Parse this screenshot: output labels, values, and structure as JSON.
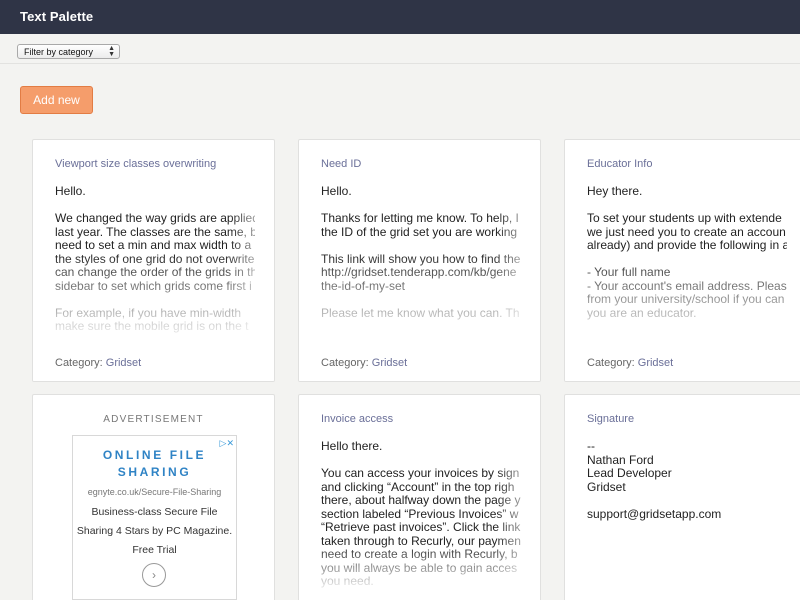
{
  "app": {
    "title": "Text Palette"
  },
  "filter": {
    "label": "Filter by category"
  },
  "actions": {
    "add_new": "Add new"
  },
  "category_prefix": "Category:",
  "cards": [
    {
      "title": "Viewport size classes overwriting",
      "lines": [
        "Hello.",
        "",
        "We changed the way grids are applied",
        "last year. The classes are the same, b",
        "need to set a min and max width to a",
        "the styles of one grid do not overwrite",
        "can change the order of the grids in th",
        "sidebar to set which grids come first i",
        "",
        "For example, if you have min-width",
        "make sure the mobile grid is on the t"
      ],
      "category": "Gridset"
    },
    {
      "title": "Need ID",
      "lines": [
        "Hello.",
        "",
        "Thanks for letting me know. To help, I",
        "the ID of the grid set you are working",
        "",
        "This link will show you how to find the",
        "http://gridset.tenderapp.com/kb/gene",
        "the-id-of-my-set",
        "",
        "Please let me know what you can. Th"
      ],
      "category": "Gridset"
    },
    {
      "title": "Educator Info",
      "lines": [
        "Hey there.",
        "",
        "To set your students up with extende",
        "we just need you to create an accoun",
        "already) and provide the following in a",
        "",
        "- Your full name",
        "- Your account's email address. Pleas",
        "from your university/school if you can",
        "you are an educator."
      ],
      "category": "Gridset"
    },
    {
      "title": "Invoice access",
      "lines": [
        "Hello there.",
        "",
        "You can access your invoices by sign",
        "and clicking “Account” in the top righ",
        "there, about halfway down the page y",
        "section labeled “Previous Invoices” w",
        "“Retrieve past invoices”. Click the link",
        "taken through to Recurly, our paymen",
        "need to create a login with Recurly, b",
        "you will always be able to gain acces",
        "you need."
      ]
    },
    {
      "title": "Signature",
      "lines": [
        "--",
        "Nathan Ford",
        "Lead Developer",
        "Gridset",
        "",
        "support@gridsetapp.com"
      ]
    }
  ],
  "ad": {
    "label": "ADVERTISEMENT",
    "headline": "ONLINE FILE SHARING",
    "url": "egnyte.co.uk/Secure-File-Sharing",
    "text": "Business-class Secure File Sharing 4 Stars by PC Magazine. Free Trial",
    "choices_icon": "adchoices-icon",
    "go_icon": "chevron-right-circle-icon"
  }
}
